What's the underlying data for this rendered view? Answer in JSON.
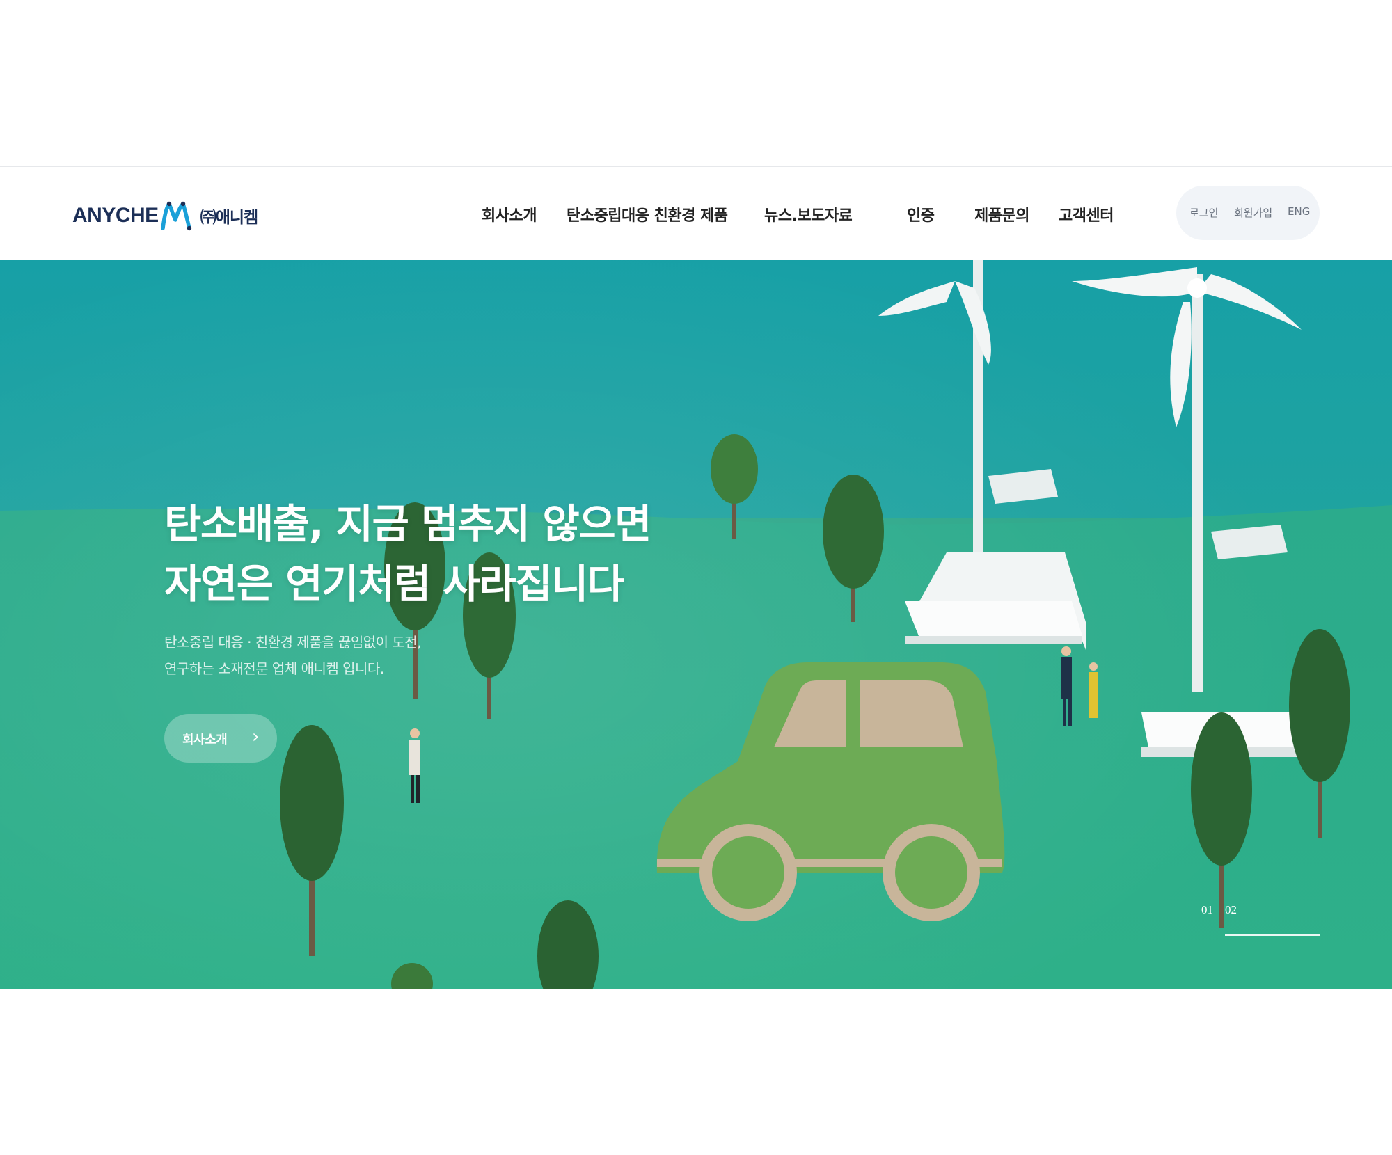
{
  "brand": {
    "logo_wordmark": "ANYCHE",
    "logo_ko": "㈜애니켐",
    "logo_m_icon": "stylized-m-icon",
    "colors": {
      "navy": "#1c2f57",
      "blue": "#1aa0d8"
    }
  },
  "gnb": {
    "items": [
      {
        "label": "회사소개"
      },
      {
        "label": "탄소중립대응 친환경 제품"
      },
      {
        "label": "뉴스.보도자료"
      },
      {
        "label": "인증"
      },
      {
        "label": "제품문의"
      },
      {
        "label": "고객센터"
      }
    ]
  },
  "util": {
    "login": "로그인",
    "join": "회원가입",
    "lang": "ENG"
  },
  "hero": {
    "title_line1": "탄소배출, 지금 멈추지 않으면",
    "title_line2": "자연은 연기처럼 사라집니다",
    "desc_line1": "탄소중립 대응 · 친환경 제품을 끊임없이 도전,",
    "desc_line2": "연구하는 소재전문 업체 애니켐 입니다.",
    "button_label": "회사소개",
    "button_icon": "chevron-right-icon",
    "pager": {
      "current": "01",
      "next": "02"
    },
    "colors": {
      "sky": "#1e9ea3",
      "ground": "#2fb08b",
      "car": "#6dab55"
    }
  }
}
